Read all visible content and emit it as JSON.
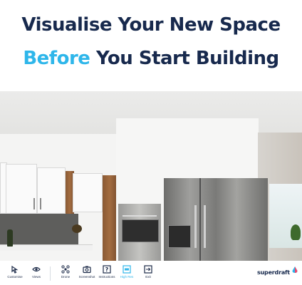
{
  "headline": {
    "line1": "Visualise Your New Space",
    "line2_accent": "Before",
    "line2_rest": "You Start Building"
  },
  "colors": {
    "navy": "#17294d",
    "accent": "#2eb6ea"
  },
  "scene": {
    "description_icon": "kitchen-render-image"
  },
  "toolbar": {
    "items": [
      {
        "label": "Customise",
        "icon": "customise-icon"
      },
      {
        "label": "Views",
        "icon": "eye-icon"
      },
      {
        "label": "Drone",
        "icon": "drone-icon"
      },
      {
        "label": "Screenshot",
        "icon": "camera-icon"
      },
      {
        "label": "Instructions",
        "icon": "question-icon"
      },
      {
        "label": "High Res",
        "icon": "high-res-icon"
      },
      {
        "label": "Exit",
        "icon": "exit-icon"
      }
    ]
  },
  "brand": {
    "name": "superdraft",
    "icon": "superdraft-logo-icon"
  }
}
